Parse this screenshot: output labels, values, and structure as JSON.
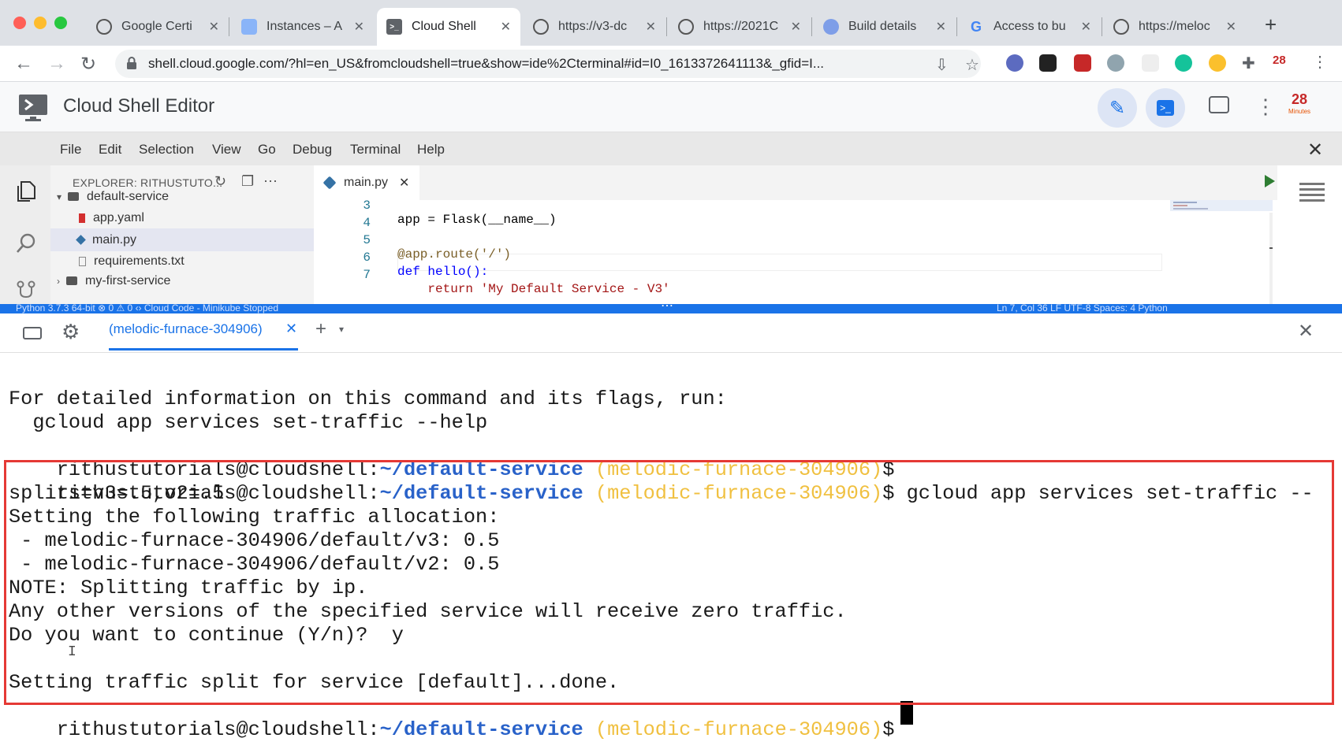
{
  "browser": {
    "tabs": [
      {
        "title": "Google Certi",
        "icon": "globe-icon",
        "active": false
      },
      {
        "title": "Instances – A",
        "icon": "cloud-icon",
        "active": false
      },
      {
        "title": "Cloud Shell",
        "icon": "terminal-icon",
        "active": true
      },
      {
        "title": "https://v3-dc",
        "icon": "globe-icon",
        "active": false
      },
      {
        "title": "https://2021C",
        "icon": "globe-icon",
        "active": false
      },
      {
        "title": "Build details",
        "icon": "build-icon",
        "active": false
      },
      {
        "title": "Access to bu",
        "icon": "google-icon",
        "active": false
      },
      {
        "title": "https://meloc",
        "icon": "globe-icon",
        "active": false
      }
    ],
    "url": "shell.cloud.google.com/?hl=en_US&fromcloudshell=true&show=ide%2Cterminal#id=I0_1613372641113&_gfid=I...",
    "extension_badge": "28"
  },
  "app": {
    "title": "Cloud Shell Editor",
    "badge_number": "28",
    "badge_caption": "Minutes"
  },
  "menu": {
    "items": [
      "File",
      "Edit",
      "Selection",
      "View",
      "Go",
      "Debug",
      "Terminal",
      "Help"
    ]
  },
  "explorer": {
    "title": "EXPLORER: RITHUSTUTO...",
    "folder": "default-service",
    "files": [
      "app.yaml",
      "main.py",
      "requirements.txt"
    ],
    "next_folder": "my-first-service"
  },
  "editor": {
    "tab_label": "main.py",
    "lines": [
      {
        "num": "3",
        "text": "app = Flask(__name__)"
      },
      {
        "num": "4",
        "text": ""
      },
      {
        "num": "5",
        "text": "@app.route('/')"
      },
      {
        "num": "6",
        "text": "def hello():"
      },
      {
        "num": "7",
        "text": "    return 'My Default Service - V3'"
      }
    ]
  },
  "statusbar": {
    "left": "Python 3.7.3 64-bit   ⊗ 0 ⚠ 0   ‹› Cloud Code - Minikube Stopped",
    "right": "Ln 7, Col 36   LF   UTF-8   Spaces: 4   Python"
  },
  "terminal": {
    "tab_label": "(melodic-furnace-304906)",
    "prompt_user": "rithustutorials@cloudshell:",
    "prompt_path": "~/default-service",
    "prompt_project": "(melodic-furnace-304906)",
    "prompt_symbol": "$",
    "lines": {
      "l1": "For detailed information on this command and its flags, run:",
      "l2": "  gcloud app services set-traffic --help",
      "cmd": " gcloud app services set-traffic --",
      "l5": "splits=v3=.5,v2=.5",
      "l6": "Setting the following traffic allocation:",
      "l7": " - melodic-furnace-304906/default/v3: 0.5",
      "l8": " - melodic-furnace-304906/default/v2: 0.5",
      "l9": "NOTE: Splitting traffic by ip.",
      "l10": "Any other versions of the specified service will receive zero traffic.",
      "l11": "Do you want to continue (Y/n)?  y",
      "l13": "Setting traffic split for service [default]...done."
    }
  },
  "colors": {
    "accent": "#1a73e8",
    "highlight_border": "#e53935",
    "prompt_path": "#2962c9",
    "prompt_project": "#f0c040"
  }
}
